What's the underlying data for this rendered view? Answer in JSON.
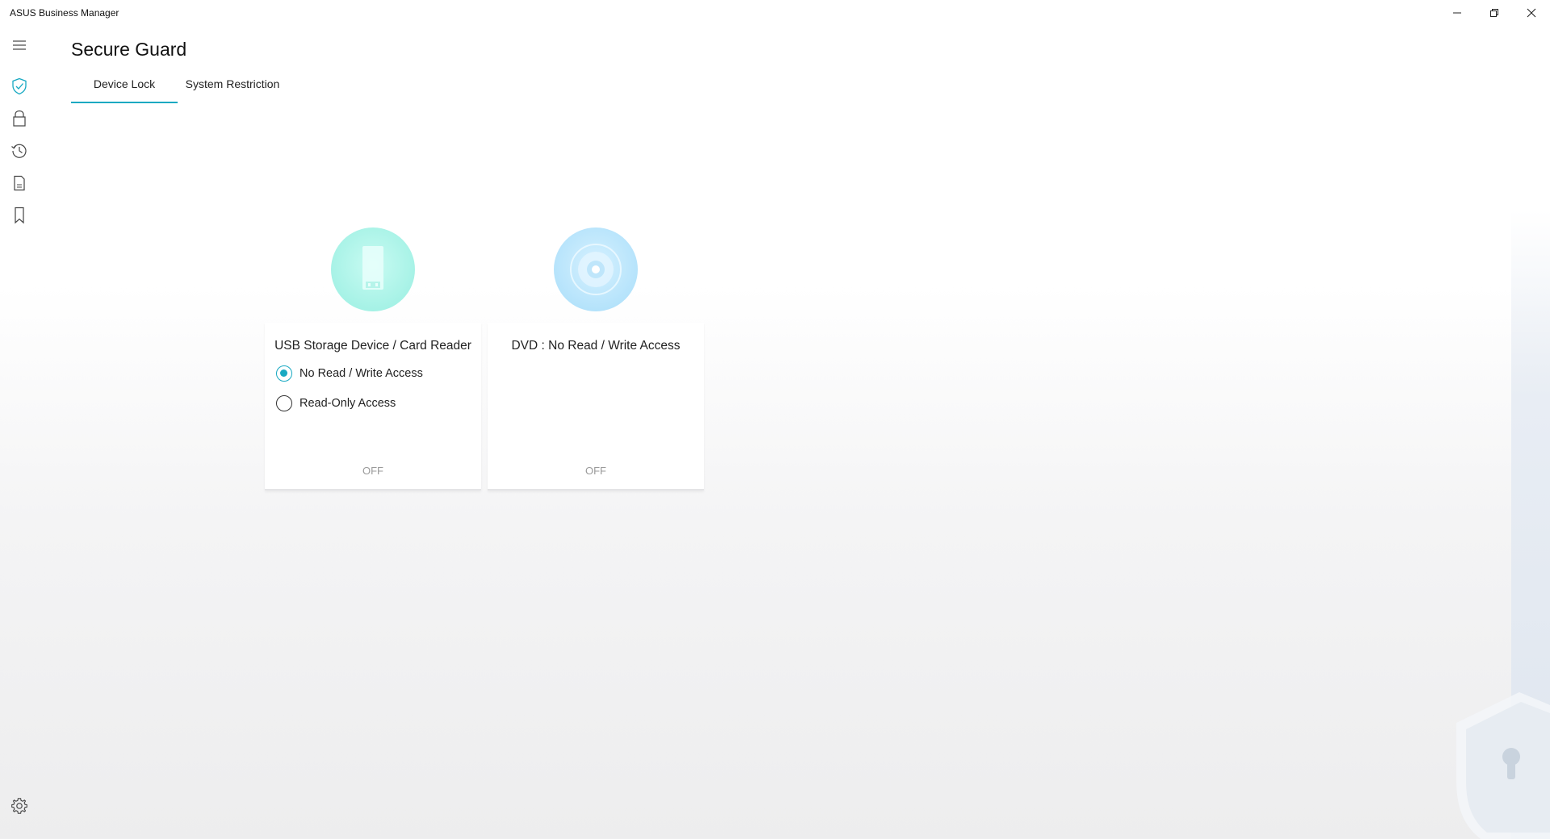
{
  "window": {
    "title": "ASUS Business Manager"
  },
  "sidebar": {
    "items": [
      {
        "icon": "hamburger-menu-icon"
      },
      {
        "icon": "shield-check-icon",
        "active": true
      },
      {
        "icon": "lock-icon"
      },
      {
        "icon": "history-icon"
      },
      {
        "icon": "document-icon"
      },
      {
        "icon": "bookmark-icon"
      }
    ],
    "settings_icon": "gear-icon",
    "accent_color": "#18a9c2"
  },
  "header": {
    "title": "Secure Guard",
    "tabs": [
      {
        "label": "Device Lock",
        "active": true
      },
      {
        "label": "System Restriction",
        "active": false
      }
    ]
  },
  "cards": [
    {
      "icon": "usb-device-icon",
      "title": "USB Storage Device / Card Reader",
      "options": [
        {
          "label": "No Read / Write Access",
          "selected": true
        },
        {
          "label": "Read-Only Access",
          "selected": false
        }
      ],
      "status": "OFF"
    },
    {
      "icon": "dvd-disc-icon",
      "title": "DVD : No Read / Write Access",
      "status": "OFF"
    }
  ]
}
